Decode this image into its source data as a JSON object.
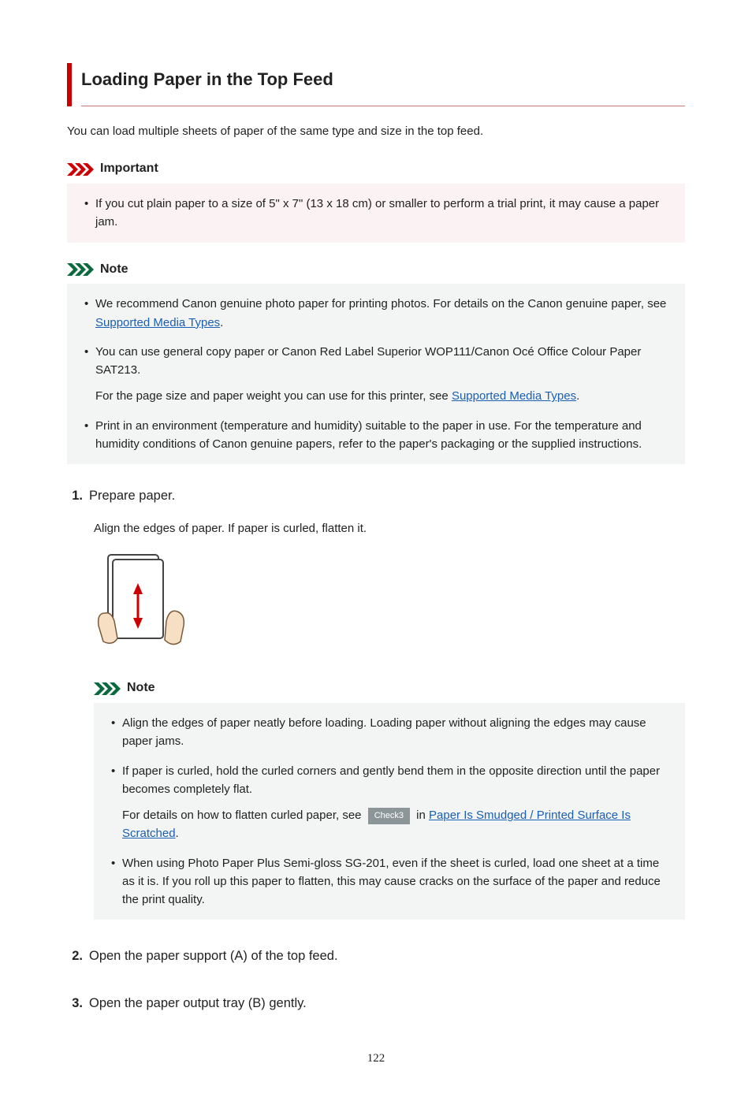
{
  "title": "Loading Paper in the Top Feed",
  "intro": "You can load multiple sheets of paper of the same type and size in the top feed.",
  "important": {
    "label": "Important",
    "items": [
      "If you cut plain paper to a size of 5\" x 7\" (13 x 18 cm) or smaller to perform a trial print, it may cause a paper jam."
    ]
  },
  "note1": {
    "label": "Note",
    "item1_pre": "We recommend Canon genuine photo paper for printing photos. For details on the Canon genuine paper, see ",
    "item1_link": "Supported Media Types",
    "item1_post": ".",
    "item2": "You can use general copy paper or Canon Red Label Superior WOP111/Canon Océ Office Colour Paper SAT213.",
    "item2_sub_pre": "For the page size and paper weight you can use for this printer, see ",
    "item2_sub_link": "Supported Media Types",
    "item2_sub_post": ".",
    "item3": "Print in an environment (temperature and humidity) suitable to the paper in use. For the temperature and humidity conditions of Canon genuine papers, refer to the paper's packaging or the supplied instructions."
  },
  "step1": {
    "num": "1",
    "title": "Prepare paper.",
    "body": "Align the edges of paper. If paper is curled, flatten it.",
    "note_label": "Note",
    "note_item1": "Align the edges of paper neatly before loading. Loading paper without aligning the edges may cause paper jams.",
    "note_item2": "If paper is curled, hold the curled corners and gently bend them in the opposite direction until the paper becomes completely flat.",
    "note_item2_sub_pre": "For details on how to flatten curled paper, see ",
    "note_item2_badge": "Check3",
    "note_item2_sub_mid": " in ",
    "note_item2_link": "Paper Is Smudged / Printed Surface Is Scratched",
    "note_item2_sub_post": ".",
    "note_item3": "When using Photo Paper Plus Semi-gloss SG-201, even if the sheet is curled, load one sheet at a time as it is. If you roll up this paper to flatten, this may cause cracks on the surface of the paper and reduce the print quality."
  },
  "step2": {
    "num": "2",
    "title": "Open the paper support (A) of the top feed."
  },
  "step3": {
    "num": "3",
    "title": "Open the paper output tray (B) gently."
  },
  "pagenum": "122"
}
